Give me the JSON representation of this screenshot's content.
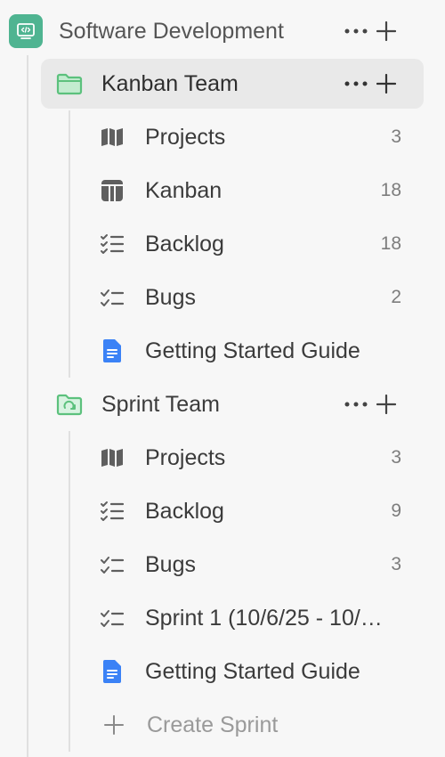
{
  "space": {
    "title": "Software Development",
    "icon": "code-space-icon",
    "accent": "#4fb491"
  },
  "folders": [
    {
      "name": "Kanban Team",
      "icon": "folder-icon",
      "items": [
        {
          "label": "Projects",
          "count": "3",
          "icon": "map-icon"
        },
        {
          "label": "Kanban",
          "count": "18",
          "icon": "board-icon"
        },
        {
          "label": "Backlog",
          "count": "18",
          "icon": "backlog-list-icon"
        },
        {
          "label": "Bugs",
          "count": "2",
          "icon": "checklist-icon"
        },
        {
          "label": "Getting Started Guide",
          "count": "",
          "icon": "document-icon"
        }
      ]
    },
    {
      "name": "Sprint Team",
      "icon": "sprint-folder-icon",
      "items": [
        {
          "label": "Projects",
          "count": "3",
          "icon": "map-icon"
        },
        {
          "label": "Backlog",
          "count": "9",
          "icon": "backlog-list-icon"
        },
        {
          "label": "Bugs",
          "count": "3",
          "icon": "checklist-icon"
        },
        {
          "label": "Sprint 1 (10/6/25 - 10/…",
          "count": "",
          "icon": "checklist-icon"
        },
        {
          "label": "Getting Started Guide",
          "count": "",
          "icon": "document-icon"
        }
      ],
      "create_label": "Create Sprint"
    }
  ],
  "colors": {
    "folder_green": "#5cc17d",
    "doc_blue": "#3b82f6",
    "icon_gray": "#5f5f5f"
  }
}
